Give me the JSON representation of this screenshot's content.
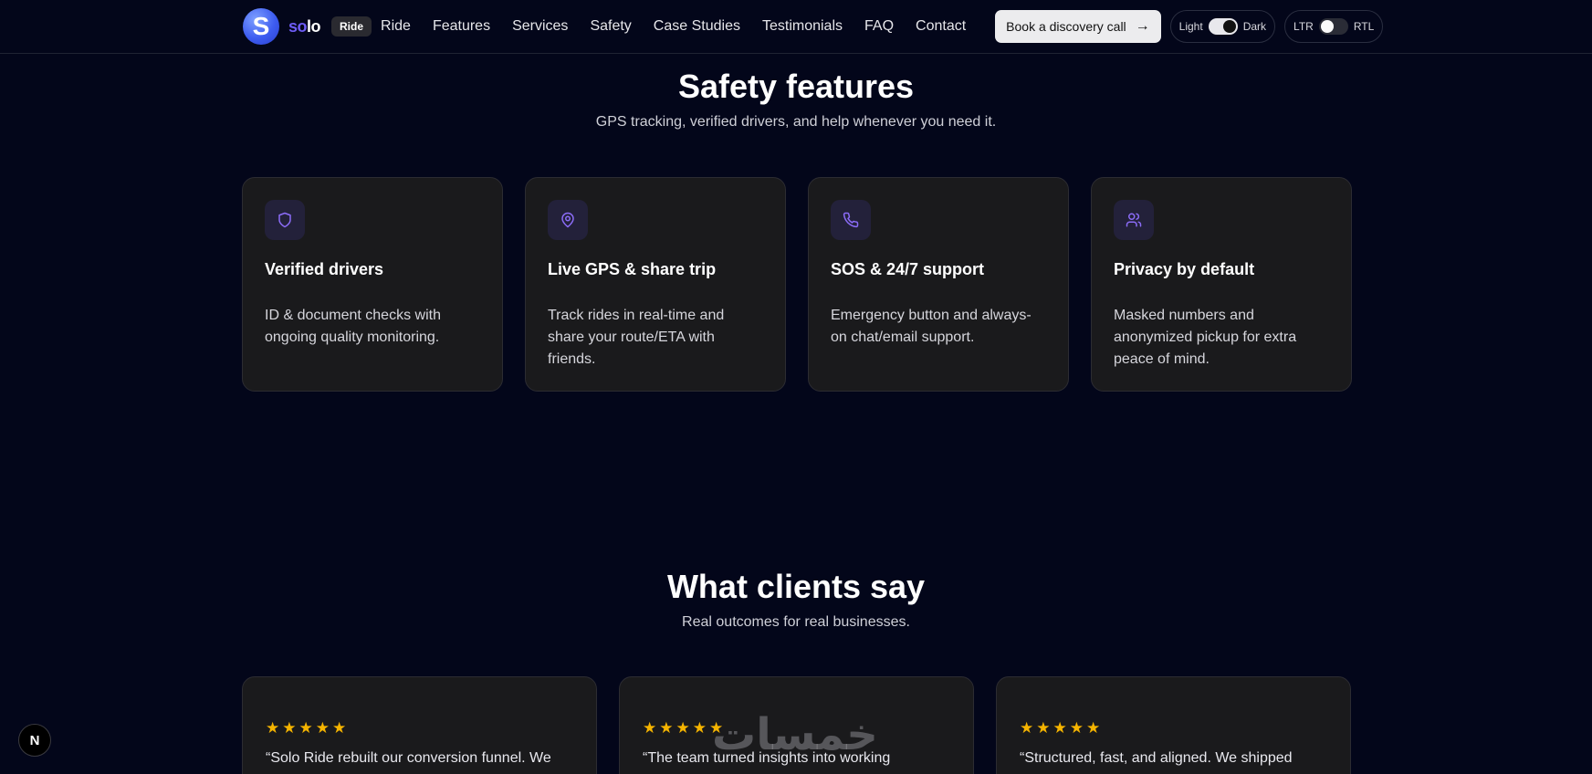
{
  "header": {
    "logo_letter": "S",
    "logo_text_prefix": "so",
    "logo_text_suffix": "lo",
    "badge": "Ride",
    "nav": [
      "Ride",
      "Features",
      "Services",
      "Safety",
      "Case Studies",
      "Testimonials",
      "FAQ",
      "Contact"
    ],
    "cta_label": "Book a discovery call",
    "theme_toggle": {
      "left": "Light",
      "right": "Dark",
      "state": "dark"
    },
    "dir_toggle": {
      "left": "LTR",
      "right": "RTL",
      "state": "ltr"
    }
  },
  "safety": {
    "title": "Safety features",
    "subtitle": "GPS tracking, verified drivers, and help whenever you need it.",
    "cards": [
      {
        "icon": "shield-icon",
        "title": "Verified drivers",
        "desc": "ID & document checks with ongoing quality monitoring."
      },
      {
        "icon": "map-pin-icon",
        "title": "Live GPS & share trip",
        "desc": "Track rides in real-time and share your route/ETA with friends."
      },
      {
        "icon": "phone-icon",
        "title": "SOS & 24/7 support",
        "desc": "Emergency button and always-on chat/email support."
      },
      {
        "icon": "users-icon",
        "title": "Privacy by default",
        "desc": "Masked numbers and anonymized pickup for extra peace of mind."
      }
    ]
  },
  "testimonials": {
    "title": "What clients say",
    "subtitle": "Real outcomes for real businesses.",
    "items": [
      {
        "rating": 5,
        "quote": "“Solo Ride rebuilt our conversion funnel. We"
      },
      {
        "rating": 5,
        "quote": "“The team turned insights into working"
      },
      {
        "rating": 5,
        "quote": "“Structured, fast, and aligned. We shipped"
      }
    ]
  },
  "next_badge": "N",
  "watermark": "خمسات",
  "colors": {
    "background": "#03061a",
    "card": "#1a1a1c",
    "accent": "#7c5cf5",
    "star": "#f5b400"
  }
}
